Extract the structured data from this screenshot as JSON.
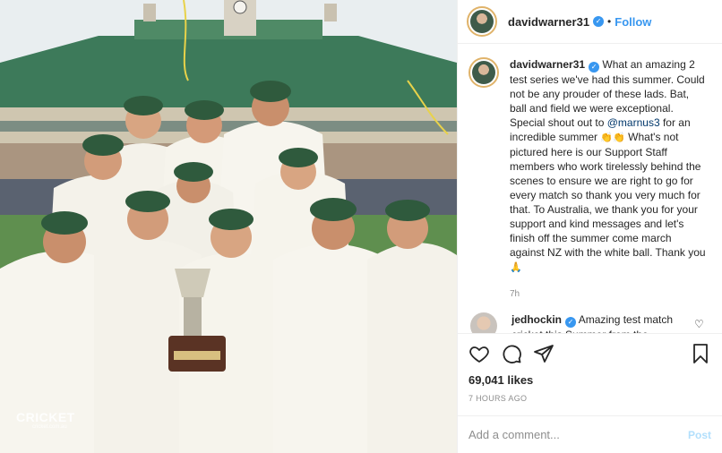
{
  "photo": {
    "watermark": "CRICKET",
    "watermark_sub": "cricket.com.au"
  },
  "header": {
    "username": "davidwarner31",
    "separator": "•",
    "follow_label": "Follow"
  },
  "caption": {
    "username": "davidwarner31",
    "text_1": "What an amazing 2 test series we've had this summer. Could not be any prouder of these lads. Bat, ball and field we were exceptional. Special shout out to",
    "mention": "@marnus3",
    "text_2": "for an incredible summer",
    "emoji_1": "👏👏",
    "text_3": "What's not pictured here is our Support Staff members who work tirelessly behind the scenes to ensure we are right to go for every match so thank you very much for that. To Australia, we thank you for your support and kind messages and let's finish off the summer come march against NZ with the white ball. Thank you",
    "emoji_2": "🙏",
    "time": "7h"
  },
  "reply": {
    "username": "jedhockin",
    "text": "Amazing test match cricket this Summer from the"
  },
  "actions": {
    "likes": "69,041 likes",
    "posted": "7 HOURS AGO"
  },
  "add_comment": {
    "placeholder": "Add a comment...",
    "post_label": "Post"
  },
  "colors": {
    "accent": "#3897f0",
    "post_disabled": "#b2dffc",
    "grass": "#5f8f4f",
    "cap": "#2f5a3d"
  }
}
